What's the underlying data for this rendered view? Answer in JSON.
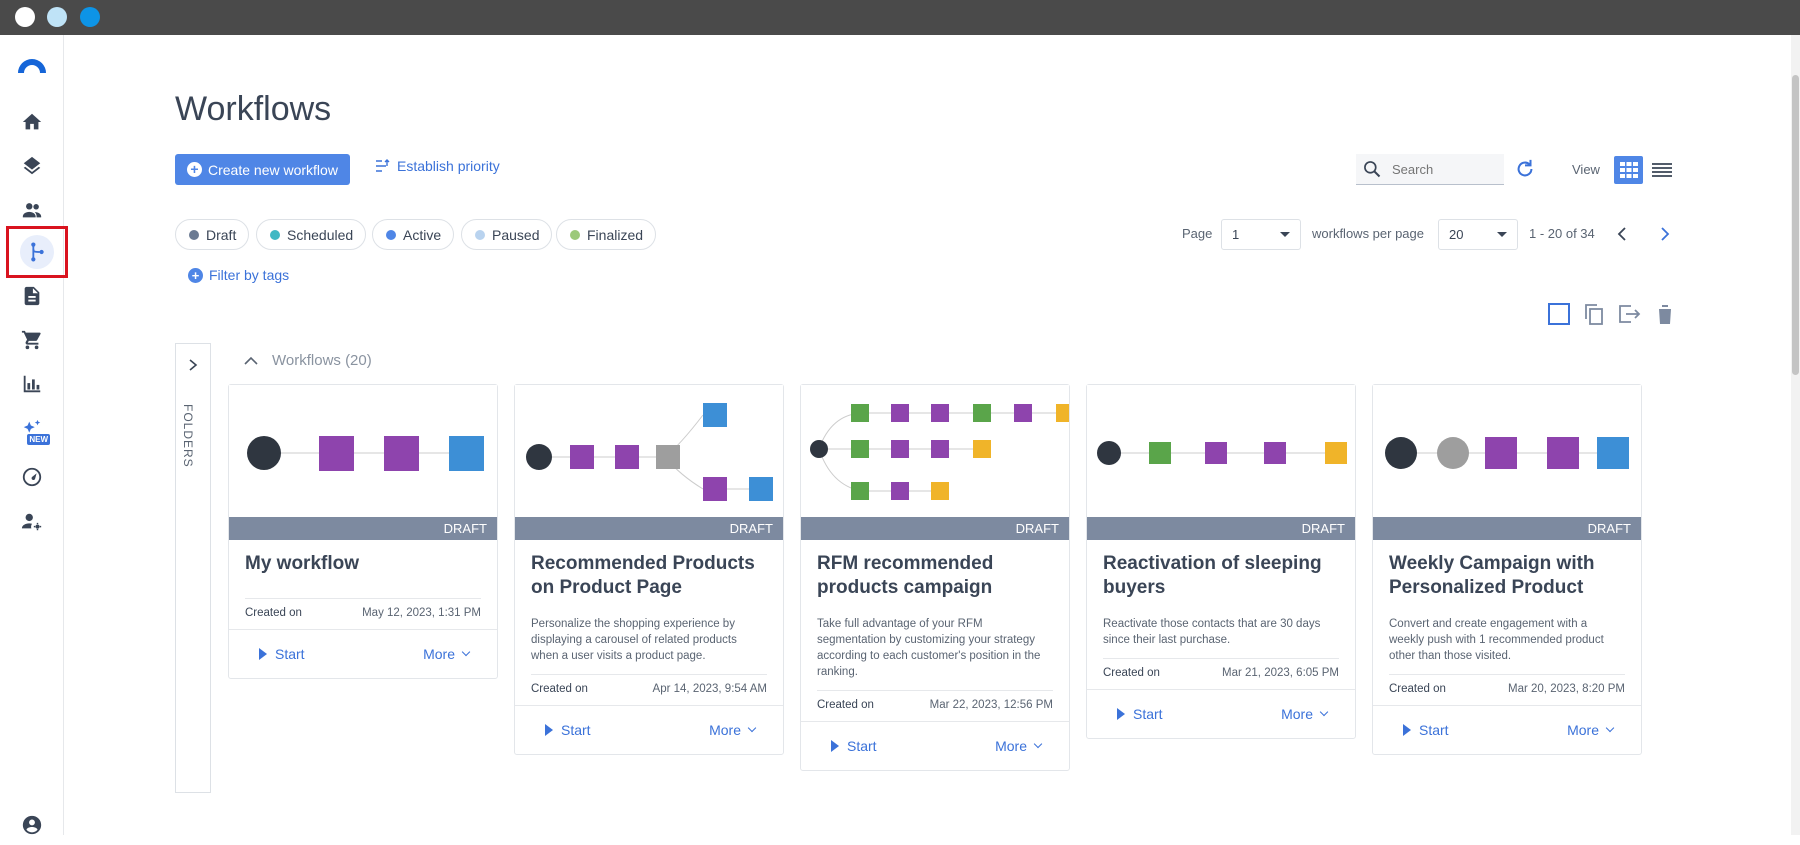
{
  "page": {
    "title": "Workflows"
  },
  "toolbar": {
    "create_label": "Create new workflow",
    "priority_label": "Establish priority",
    "search_placeholder": "Search",
    "view_label": "View"
  },
  "status_filters": [
    {
      "label": "Draft",
      "color": "#6b7a92"
    },
    {
      "label": "Scheduled",
      "color": "#3fb8c4"
    },
    {
      "label": "Active",
      "color": "#4f86e6"
    },
    {
      "label": "Paused",
      "color": "#b9d3ef"
    },
    {
      "label": "Finalized",
      "color": "#9cc97a"
    }
  ],
  "pagination": {
    "page_label": "Page",
    "page_value": "1",
    "per_page_label": "workflows per page",
    "per_page_value": "20",
    "range": "1 - 20 of 34"
  },
  "filter_tags_label": "Filter by tags",
  "folders_label": "FOLDERS",
  "section_title": "Workflows (20)",
  "cards": [
    {
      "title": "My workflow",
      "status": "DRAFT",
      "description": "",
      "created_label": "Created on",
      "date": "May 12, 2023, 1:31 PM",
      "start": "Start",
      "more": "More"
    },
    {
      "title": "Recommended Products on Product Page",
      "status": "DRAFT",
      "description": "Personalize the shopping experience by displaying a carousel of related products when a user visits a product page.",
      "created_label": "Created on",
      "date": "Apr 14, 2023, 9:54 AM",
      "start": "Start",
      "more": "More"
    },
    {
      "title": "RFM recommended products campaign",
      "status": "DRAFT",
      "description": "Take full advantage of your RFM segmentation by customizing your strategy according to each customer's position in the ranking.",
      "created_label": "Created on",
      "date": "Mar 22, 2023, 12:56 PM",
      "start": "Start",
      "more": "More"
    },
    {
      "title": "Reactivation of sleeping buyers",
      "status": "DRAFT",
      "description": "Reactivate those contacts that are 30 days since their last purchase.",
      "created_label": "Created on",
      "date": "Mar 21, 2023, 6:05 PM",
      "start": "Start",
      "more": "More"
    },
    {
      "title": "Weekly Campaign with Personalized Product",
      "status": "DRAFT",
      "description": "Convert and create engagement with a weekly push with 1 recommended product other than those visited.",
      "created_label": "Created on",
      "date": "Mar 20, 2023, 8:20 PM",
      "start": "Start",
      "more": "More"
    }
  ],
  "sidebar": {
    "new_badge": "NEW",
    "items": [
      "home-icon",
      "layers-icon",
      "contacts-icon",
      "workflows-icon",
      "document-icon",
      "cart-icon",
      "analytics-icon",
      "ai-sparkle-icon",
      "dashboard-gauge-icon",
      "user-settings-icon"
    ]
  },
  "colors": {
    "accent": "#4f86e6",
    "status_bar": "#7d8aa0",
    "node_purple": "#8e44ad",
    "node_green": "#5aa54a",
    "node_yellow": "#f0b429",
    "node_blue": "#3d8fd6",
    "node_dark": "#2f3640"
  }
}
